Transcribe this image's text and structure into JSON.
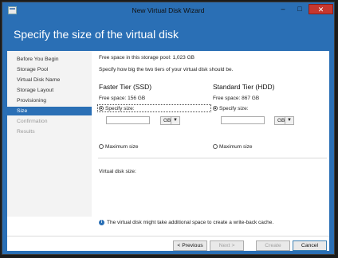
{
  "window": {
    "title": "New Virtual Disk Wizard",
    "minimize_glyph": "–",
    "maximize_glyph": "□",
    "close_glyph": "✕"
  },
  "page": {
    "title": "Specify the size of the virtual disk"
  },
  "nav": {
    "items": [
      {
        "label": "Before You Begin",
        "state": "normal"
      },
      {
        "label": "Storage Pool",
        "state": "normal"
      },
      {
        "label": "Virtual Disk Name",
        "state": "normal"
      },
      {
        "label": "Storage Layout",
        "state": "normal"
      },
      {
        "label": "Provisioning",
        "state": "normal"
      },
      {
        "label": "Size",
        "state": "active"
      },
      {
        "label": "Confirmation",
        "state": "disabled"
      },
      {
        "label": "Results",
        "state": "disabled"
      }
    ]
  },
  "content": {
    "pool_free_space": "Free space in this storage pool: 1,023 GB",
    "instruction": "Specify how big the two tiers of your virtual disk should be.",
    "faster_tier": {
      "title": "Faster Tier (SSD)",
      "free_space": "Free space: 156 GB",
      "specify_label": "Specify size:",
      "size_value": "",
      "unit": "GB",
      "max_label": "Maximum size",
      "selected": "specify"
    },
    "standard_tier": {
      "title": "Standard Tier (HDD)",
      "free_space": "Free space: 867 GB",
      "specify_label": "Specify size:",
      "size_value": "",
      "unit": "GB",
      "max_label": "Maximum size",
      "selected": "specify"
    },
    "virtual_disk_size_label": "Virtual disk size:",
    "info_text": "The virtual disk might take additional space to create a write-back cache.",
    "info_icon": "info-icon"
  },
  "footer": {
    "previous": "< Previous",
    "next": "Next >",
    "create": "Create",
    "cancel": "Cancel"
  },
  "colors": {
    "accent": "#2a6fb5",
    "close": "#c7372f"
  }
}
